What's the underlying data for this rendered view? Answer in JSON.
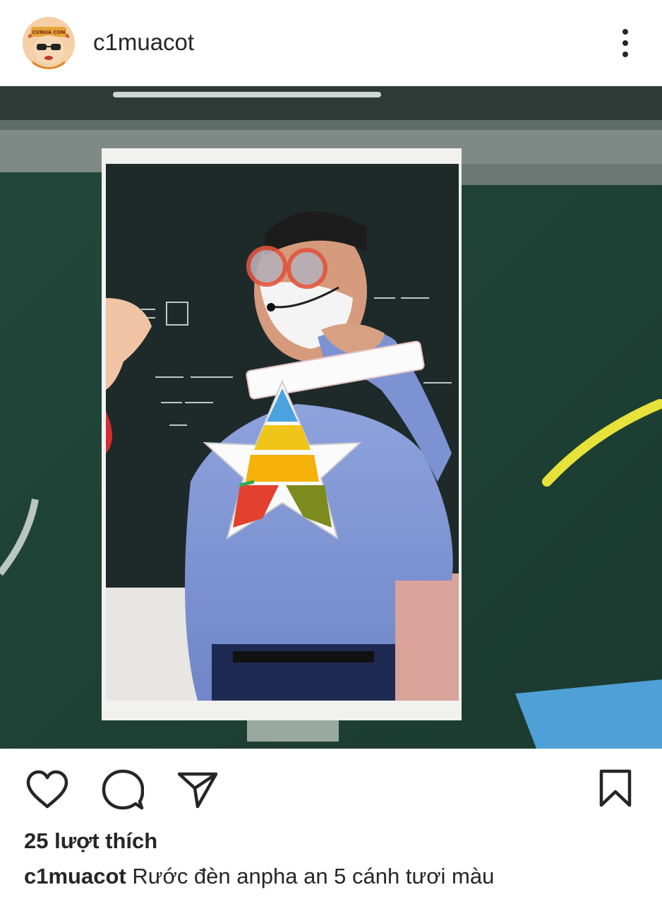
{
  "post": {
    "username": "c1muacot",
    "avatar_badge": "CUNUA CON",
    "likes_text": "25 lượt thích",
    "caption_user": "c1muacot",
    "caption_text": " Rước đèn anpha an 5 cánh tươi màu"
  },
  "icons": {
    "more": "more-vertical-icon",
    "like": "heart-icon",
    "comment": "comment-bubble-icon",
    "share": "send-paper-plane-icon",
    "save": "bookmark-icon"
  },
  "colors": {
    "text": "#262626",
    "background": "#ffffff",
    "chalkboard": "#1e3d33"
  }
}
